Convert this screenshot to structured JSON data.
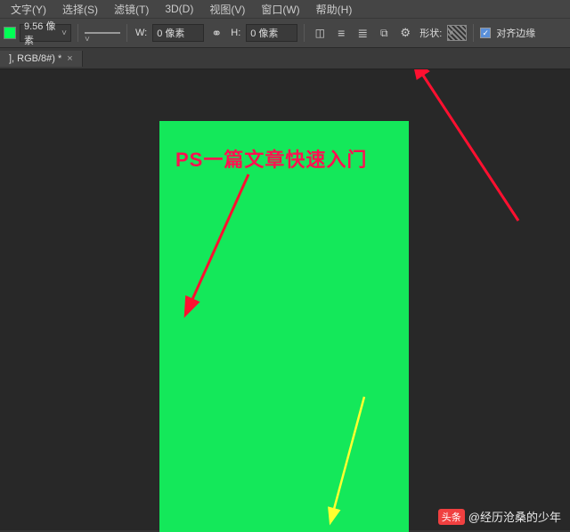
{
  "menu": {
    "type": "文字(Y)",
    "select": "选择(S)",
    "filter": "滤镜(T)",
    "threeD": "3D(D)",
    "view": "视图(V)",
    "window": "窗口(W)",
    "help": "帮助(H)"
  },
  "options": {
    "strokeWidth": "9.56 像素",
    "wLabel": "W:",
    "wValue": "0 像素",
    "hLabel": "H:",
    "hValue": "0 像素",
    "shapeLabel": "形状:",
    "alignLabel": "对齐边缘"
  },
  "tab": {
    "title": "], RGB/8#) *",
    "close": "×"
  },
  "canvas": {
    "headline": "PS一篇文章快速入门"
  },
  "watermark": {
    "badge": "头条",
    "text": "@经历沧桑的少年"
  }
}
